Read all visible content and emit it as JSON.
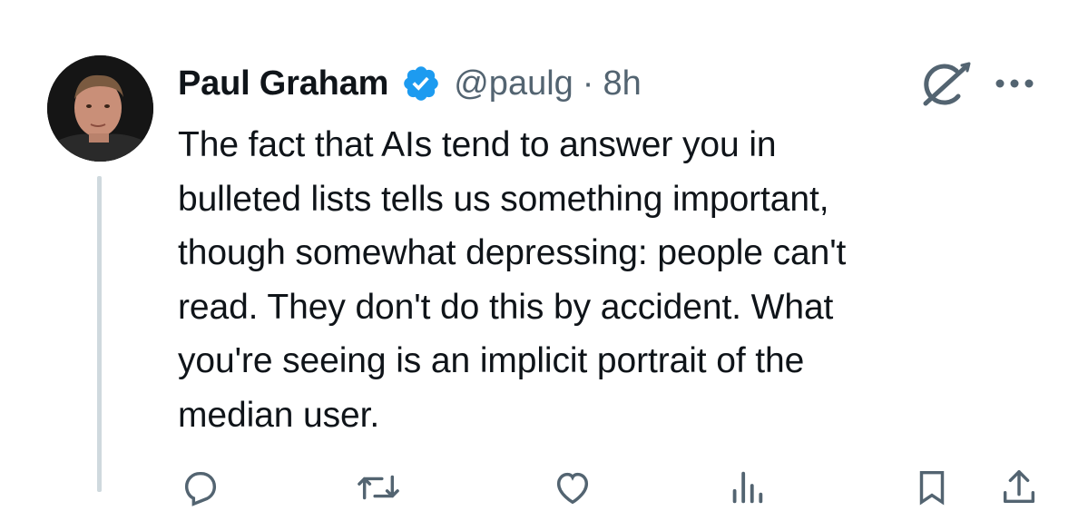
{
  "author": {
    "display_name": "Paul Graham",
    "handle": "@paulg",
    "separator": "·",
    "time": "8h",
    "verified_color": "#1d9bf0"
  },
  "tweet": {
    "text": "The fact that AIs tend to answer you in\nbulleted lists tells us something important,\nthough somewhat depressing: people can't\nread. They don't do this by accident. What\nyou're seeing is an implicit portrait of the\nmedian user."
  },
  "icons": {
    "verified": "verified-badge-icon",
    "grok": "grok-icon",
    "more": "more-options-icon",
    "reply": "reply-icon",
    "repost": "repost-icon",
    "like": "like-icon",
    "views": "views-icon",
    "bookmark": "bookmark-icon",
    "share": "share-icon"
  },
  "colors": {
    "text_primary": "#0f1419",
    "text_secondary": "#536471",
    "thread_line": "#cfd9de"
  }
}
